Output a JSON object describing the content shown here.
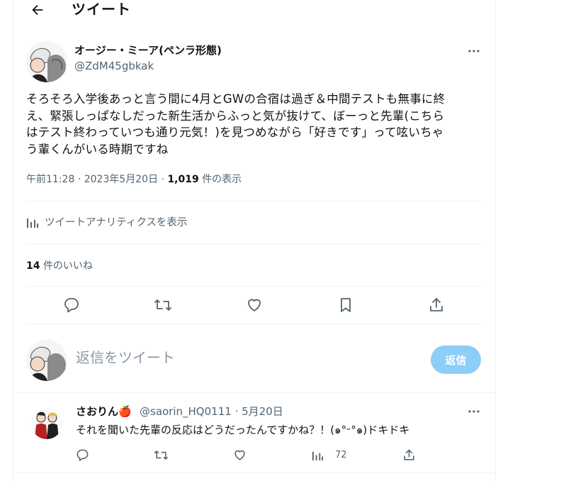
{
  "header": {
    "title": "ツイート",
    "back_icon": "arrow-left-icon"
  },
  "tweet": {
    "author": {
      "name": "オージー・ミーア(ペンラ形態)",
      "handle": "@ZdM45gbkak"
    },
    "text": "そろそろ入学後あっと言う間に4月とGWの合宿は過ぎ＆中間テストも無事に終\nえ、緊張しっぱなしだった新生活からふっと気が抜けて、ぼーっと先輩(こちら\nはテスト終わっていつも通り元気！)を見つめながら「好きです」って呟いちゃ\nう輩くんがいる時期ですね",
    "time": "午前11:28",
    "separator": "·",
    "date": "2023年5月20日",
    "views_count": "1,019",
    "views_label": "件の表示",
    "analytics_label": "ツイートアナリティクスを表示",
    "likes_count": "14",
    "likes_label": "件のいいね"
  },
  "reply_box": {
    "placeholder": "返信をツイート",
    "button_label": "返信",
    "button_color": "#8ecdf8"
  },
  "reply": {
    "name": "さおりん",
    "emoji": "🍎",
    "handle": "@saorin_HQ0111",
    "separator": "·",
    "date": "5月20日",
    "text": "それを聞いた先輩の反応はどうだったんですかね？！(๑°ᵕ°๑)ドキドキ",
    "views": "72"
  },
  "colors": {
    "text": "#0f1419",
    "secondary": "#536471",
    "divider": "#eff3f4",
    "accent": "#1d9bf0"
  }
}
